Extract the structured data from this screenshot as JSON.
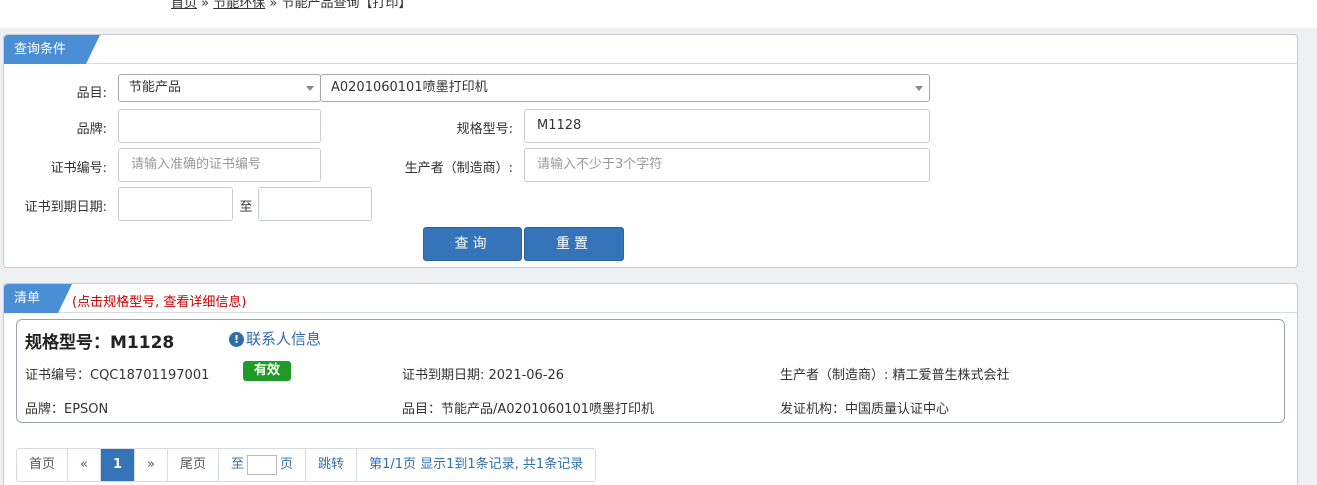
{
  "breadcrumb": {
    "home": "首页",
    "sep1": "»",
    "section": "节能环保",
    "sep2": "»",
    "page": "节能产品查询【打印】"
  },
  "query_panel": {
    "title": "查询条件",
    "category_label": "品目:",
    "category_value": "节能产品",
    "subcategory_value": "A0201060101喷墨打印机",
    "brand_label": "品牌:",
    "brand_value": "",
    "model_label": "规格型号:",
    "model_value": "M1128",
    "cert_no_label": "证书编号:",
    "cert_no_placeholder": "请输入准确的证书编号",
    "maker_label": "生产者（制造商）:",
    "maker_placeholder": "请输入不少于3个字符",
    "expiry_label": "证书到期日期:",
    "expiry_to": "至",
    "search_button": "查询",
    "reset_button": "重置"
  },
  "list_panel": {
    "title": "清单",
    "hint": "(点击规格型号, 查看详细信息)",
    "items": [
      {
        "title": "规格型号：M1128",
        "contact": "联系人信息",
        "cert_no": "证书编号：CQC18701197001",
        "status": "有效",
        "expiry": "证书到期日期: 2021-06-26",
        "maker": "生产者（制造商）: 精工爱普生株式会社",
        "brand": "品牌：EPSON",
        "category": "品目：节能产品/A0201060101喷墨打印机",
        "issuer": "发证机构：中国质量认证中心"
      }
    ]
  },
  "pager": {
    "first": "首页",
    "prev": "«",
    "current": "1",
    "next": "»",
    "last": "尾页",
    "goto_prefix": "至",
    "goto_suffix": "页",
    "jump": "跳转",
    "summary": "第1/1页  显示1到1条记录, 共1条记录"
  },
  "colors": {
    "accent": "#3574b8",
    "tag": "#4a8fd6",
    "valid": "#229a2a",
    "hint": "#cc0000"
  }
}
